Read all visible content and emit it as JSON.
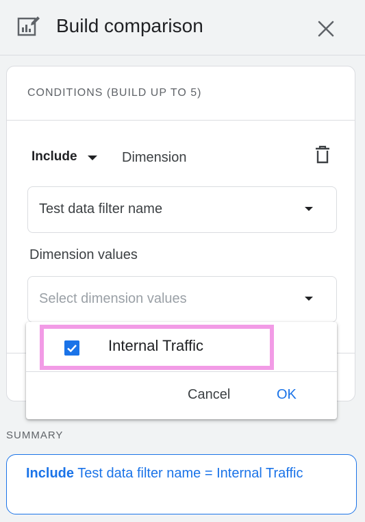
{
  "header": {
    "title": "Build comparison",
    "icon": "edit-chart-icon",
    "close_icon": "close-icon"
  },
  "conditions": {
    "title": "CONDITIONS (BUILD UP TO 5)",
    "include_label": "Include",
    "dimension_label": "Dimension",
    "delete_icon": "trash-icon",
    "dimension_select": {
      "value": "Test data filter name"
    },
    "dimension_values_label": "Dimension values",
    "values_select": {
      "placeholder": "Select dimension values"
    }
  },
  "popup": {
    "options": [
      {
        "label": "Internal Traffic",
        "checked": true
      }
    ],
    "cancel_label": "Cancel",
    "ok_label": "OK"
  },
  "summary": {
    "label": "SUMMARY",
    "include": "Include",
    "text": "Test data filter name = Internal Traffic"
  },
  "colors": {
    "accent": "#1a73e8",
    "highlight": "#f29be6"
  }
}
